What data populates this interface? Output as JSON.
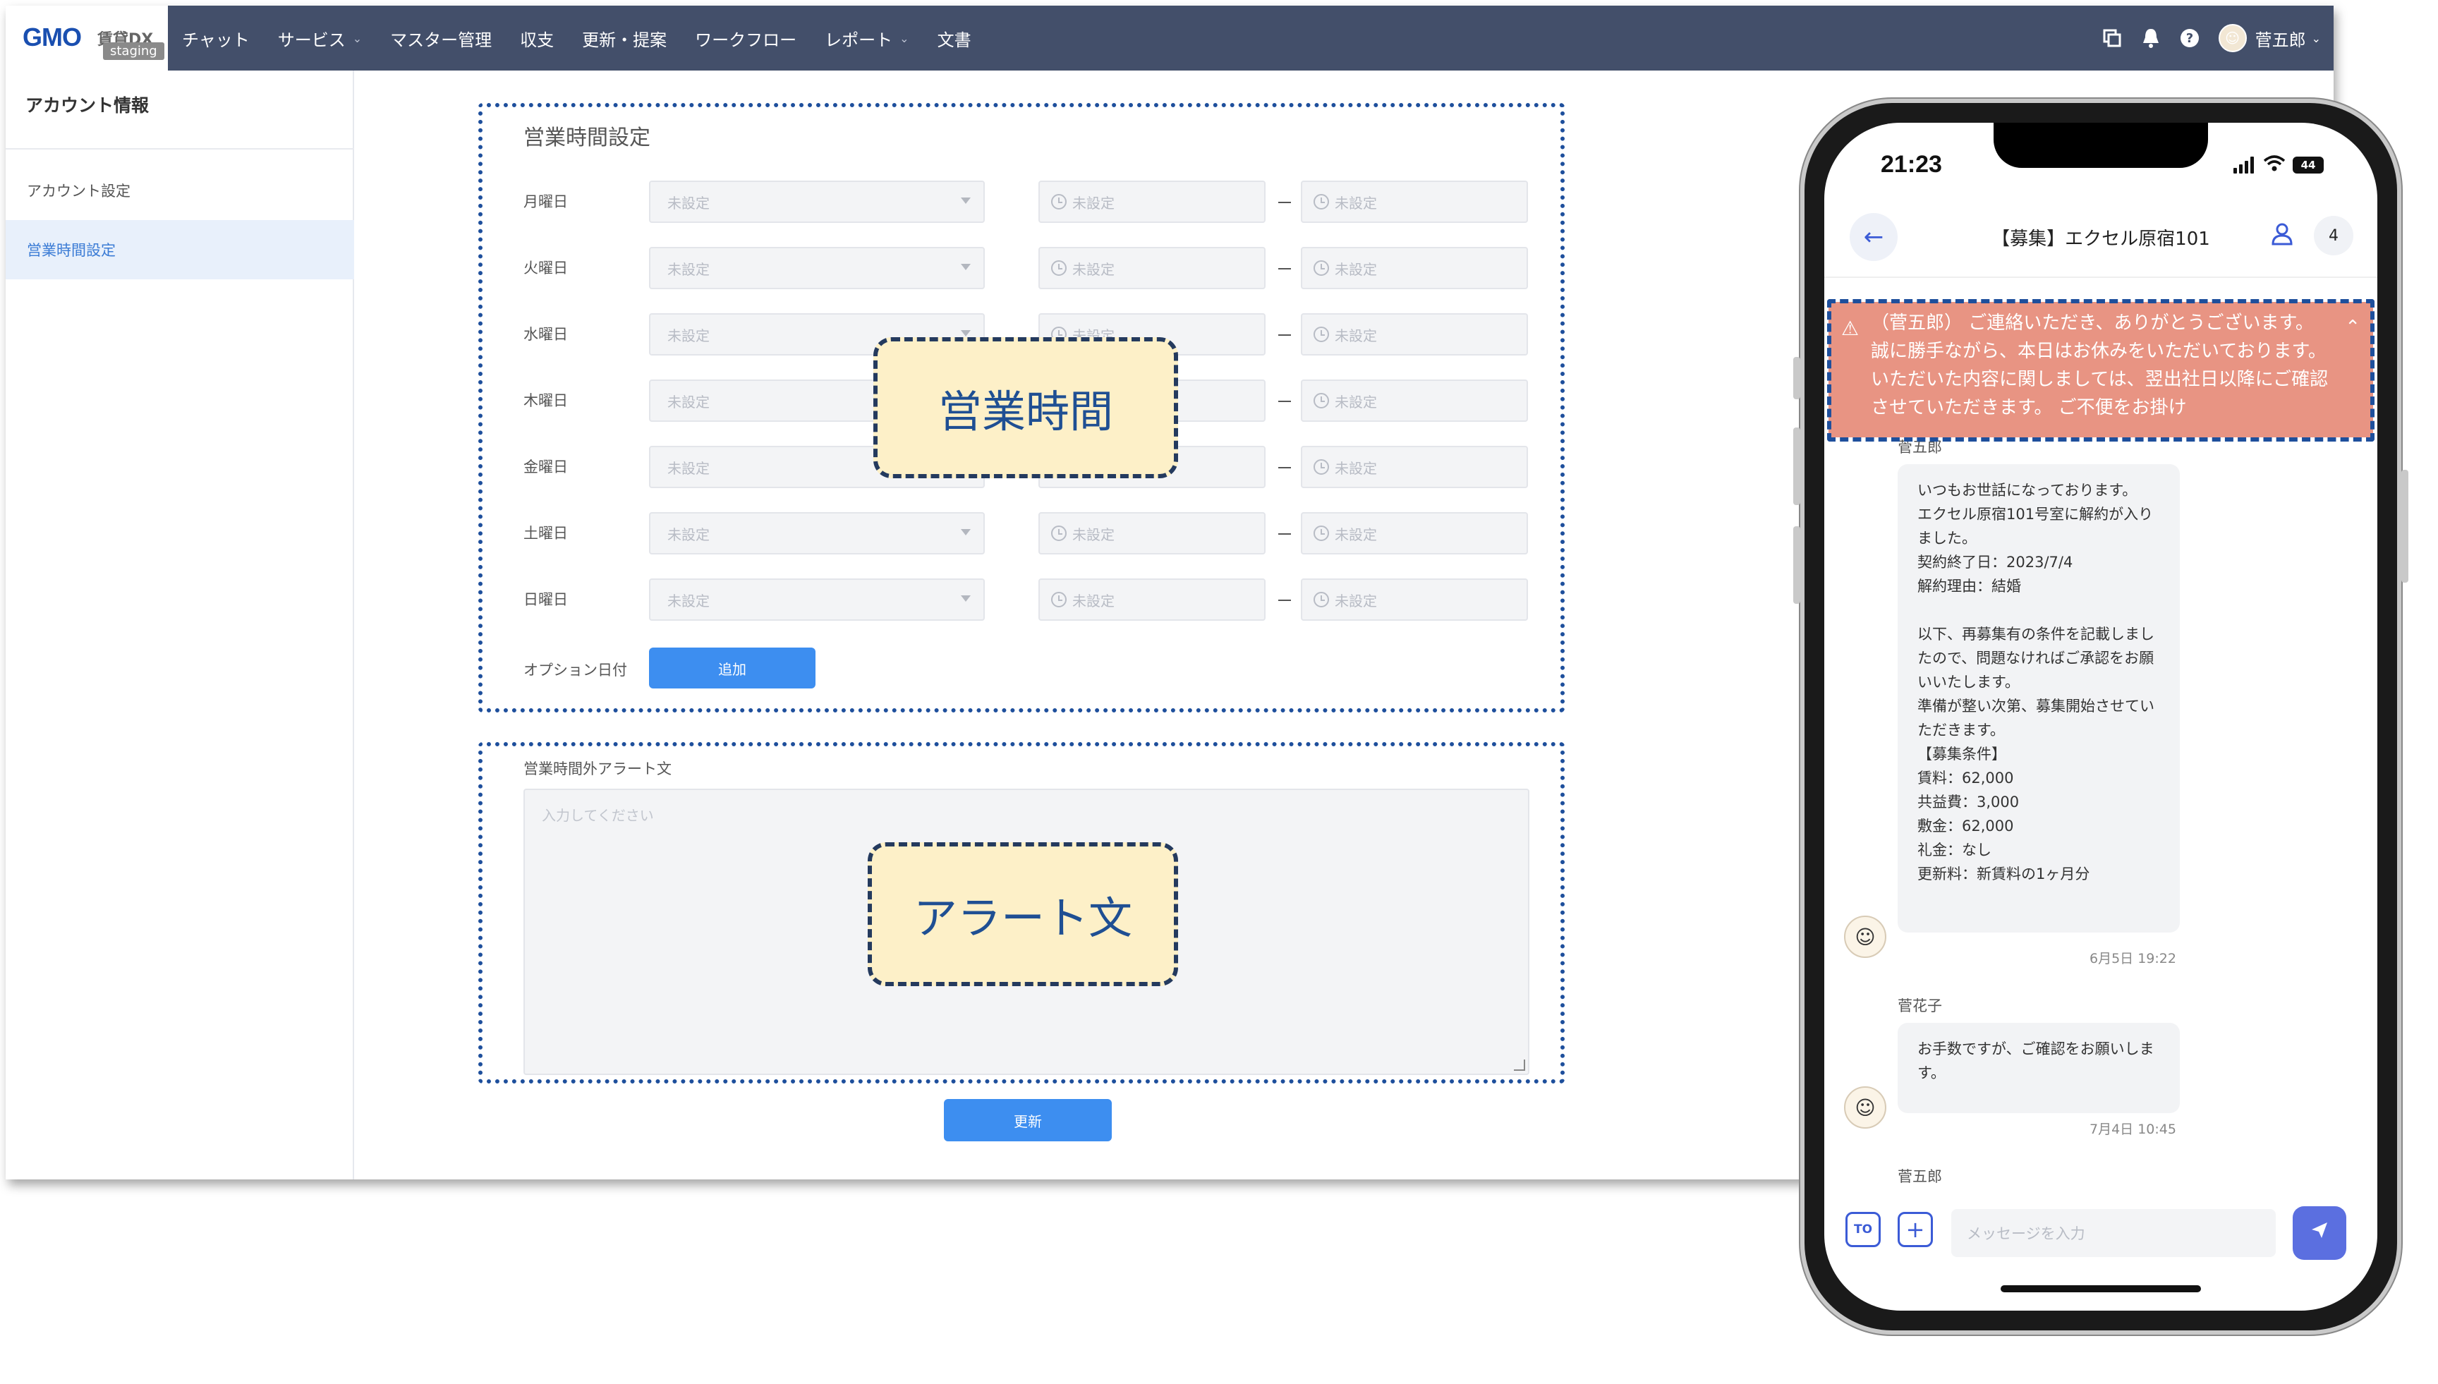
{
  "app": {
    "logo": "GMO",
    "logo_sub": "賃貸DX",
    "env_badge": "staging"
  },
  "nav": {
    "items": [
      {
        "label": "チャット",
        "dropdown": false
      },
      {
        "label": "サービス",
        "dropdown": true
      },
      {
        "label": "マスター管理",
        "dropdown": false
      },
      {
        "label": "収支",
        "dropdown": false
      },
      {
        "label": "更新・提案",
        "dropdown": false
      },
      {
        "label": "ワークフロー",
        "dropdown": false
      },
      {
        "label": "レポート",
        "dropdown": true
      },
      {
        "label": "文書",
        "dropdown": false
      }
    ],
    "user_name": "菅五郎",
    "icons": [
      "copy-icon",
      "bell-icon",
      "help-icon"
    ]
  },
  "sidebar": {
    "title": "アカウント情報",
    "items": [
      {
        "label": "アカウント設定",
        "active": false
      },
      {
        "label": "営業時間設定",
        "active": true
      }
    ]
  },
  "hours": {
    "section_title": "営業時間設定",
    "days": [
      "月曜日",
      "火曜日",
      "水曜日",
      "木曜日",
      "金曜日",
      "土曜日",
      "日曜日"
    ],
    "select_placeholder": "未設定",
    "time_placeholder": "未設定",
    "option_label": "オプション日付",
    "add_button": "追加"
  },
  "alert_text": {
    "label": "営業時間外アラート文",
    "placeholder": "入力してください"
  },
  "update_button": "更新",
  "callouts": {
    "hours": "営業時間",
    "alert": "アラート文"
  },
  "phone": {
    "status_time": "21:23",
    "battery": "44",
    "chat_title": "【募集】エクセル原宿101",
    "member_count": "4",
    "alert_banner": "（菅五郎） ご連絡いただき、ありがとうございます。 誠に勝手ながら、本日はお休みをいただいております。 いただいた内容に関しましては、翌出社日以降にご確認させていただきます。 ご不便をお掛け",
    "messages": [
      {
        "sender": "菅五郎",
        "text": "いつもお世話になっております。\nエクセル原宿101号室に解約が入りました。\n契約終了日：2023/7/4\n解約理由：結婚\n\n以下、再募集有の条件を記載しましたので、問題なければご承認をお願いいたします。\n準備が整い次第、募集開始させていただきます。\n【募集条件】\n賃料：62,000\n共益費：3,000\n敷金：62,000\n礼金：なし\n更新料：新賃料の1ヶ月分",
        "timestamp": "6月5日 19:22"
      },
      {
        "sender": "菅花子",
        "text": "お手数ですが、ご確認をお願いします。",
        "timestamp": "7月4日 10:45"
      },
      {
        "sender": "菅五郎",
        "text": "",
        "timestamp": ""
      }
    ],
    "composer": {
      "to_label": "TO",
      "plus_label": "+",
      "placeholder": "メッセージを入力"
    }
  },
  "colors": {
    "topbar": "#434f6a",
    "accent": "#3d8ef0",
    "annotation": "#1e4f9c",
    "callout_bg": "#fdf0c8",
    "alert_banner": "#e89483"
  }
}
